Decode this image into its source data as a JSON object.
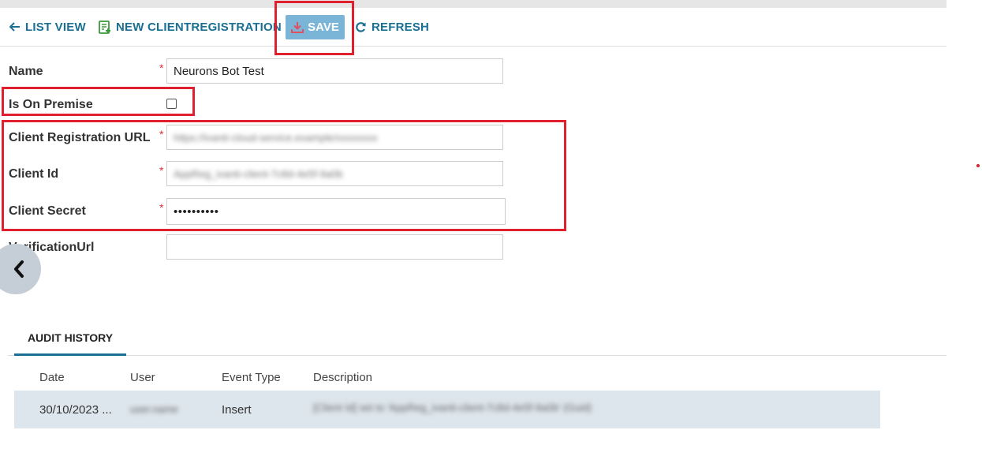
{
  "toolbar": {
    "list_view": "LIST VIEW",
    "new_client_registration": "NEW CLIENTREGISTRATION",
    "save": "SAVE",
    "refresh": "REFRESH"
  },
  "form": {
    "name_label": "Name",
    "name_value": "Neurons Bot Test",
    "on_premise_label": "Is On Premise",
    "on_premise_checked": false,
    "client_reg_url_label": "Client Registration URL",
    "client_reg_url_value": "https://ivanti-cloud-service.example/xxxxxxxx",
    "client_id_label": "Client Id",
    "client_id_value": "AppReg_ivanti-client-7c8d-4e5f-9a0b",
    "client_secret_label": "Client Secret",
    "client_secret_value": "••••••••••",
    "verification_url_label": "VerificationUrl",
    "verification_url_value": ""
  },
  "tabs": {
    "audit_history": "AUDIT HISTORY"
  },
  "audit": {
    "columns": [
      "Date",
      "User",
      "Event Type",
      "Description"
    ],
    "rows": [
      {
        "date": "30/10/2023 ...",
        "user": "user.name",
        "event_type": "Insert",
        "description": "[Client Id] set to 'AppReg_ivanti-client-7c8d-4e5f-9a0b' (Guid)"
      }
    ]
  },
  "colors": {
    "accent": "#1a6f93",
    "save_button": "#7ab4d6",
    "highlight": "#e0202e",
    "row_bg": "#dde6ec"
  }
}
